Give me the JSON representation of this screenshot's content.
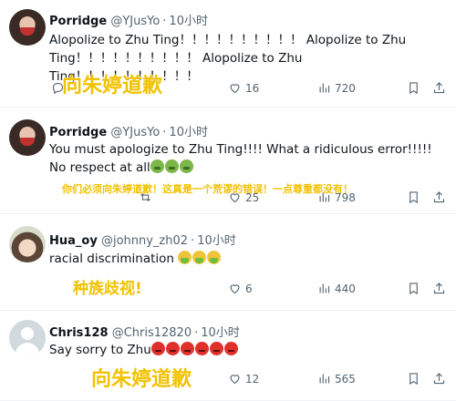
{
  "tweets": [
    {
      "name": "Porridge",
      "handle": "@YJusYo",
      "time": "10小时",
      "text": "Alopolize to Zhu Ting！！！！！！！！！！ Alopolize to Zhu Ting！！！！！！！！！！ Alopolize to Zhu Ting！！！！！！！！！！",
      "overlay": "向朱婷道歉",
      "stats": {
        "replies": "",
        "retweets": "",
        "likes": "16",
        "views": "720"
      }
    },
    {
      "name": "Porridge",
      "handle": "@YJusYo",
      "time": "10小时",
      "text": "You must apologize to Zhu Ting!!!! What a ridiculous error!!!!! No respect at all",
      "overlay": "你们必须向朱婷道歉！这真是一个荒谬的错误！一点尊重都没有！",
      "stats": {
        "replies": "",
        "retweets": "",
        "likes": "25",
        "views": "798"
      }
    },
    {
      "name": "Hua_oy",
      "handle": "@johnny_zh02",
      "time": "10小时",
      "text": "racial discrimination",
      "overlay": "种族歧视!",
      "stats": {
        "replies": "",
        "retweets": "",
        "likes": "6",
        "views": "440"
      }
    },
    {
      "name": "Chris128",
      "handle": "@Chris12820",
      "time": "10小时",
      "text": "Say sorry to Zhu",
      "overlay": "向朱婷道歉",
      "stats": {
        "replies": "",
        "retweets": "",
        "likes": "12",
        "views": "565"
      }
    }
  ],
  "icons": {
    "reply": "reply-icon",
    "retweet": "retweet-icon",
    "like": "heart-icon",
    "views": "views-icon",
    "bookmark": "bookmark-icon",
    "share": "share-icon",
    "emoji_sick": "nauseated-face-emoji",
    "emoji_angry": "angry-face-emoji",
    "emoji_vomit": "vomiting-face-emoji"
  },
  "colors": {
    "text": "#0f1419",
    "secondary": "#536471",
    "overlay": "#f2c200",
    "divider": "#eff3f4"
  }
}
